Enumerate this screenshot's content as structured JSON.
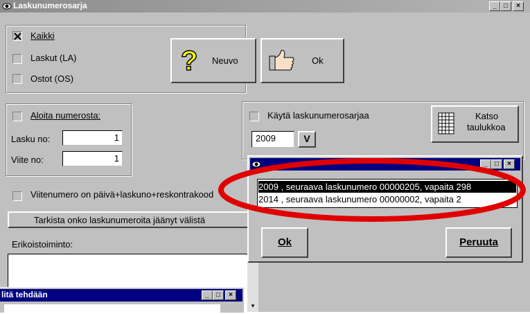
{
  "main_window": {
    "title": "Laskunumerosarja",
    "title_buttons": [
      "_",
      "□",
      "×"
    ]
  },
  "filter_group": {
    "all_label": "Kaikki",
    "all_checked": true,
    "invoices_label": "Laskut (LA)",
    "purchases_label": "Ostot (OS)"
  },
  "buttons": {
    "new_label": "Neuvo",
    "ok_label": "Ok",
    "view_table_line1": "Katso",
    "view_table_line2": "taulukkoa",
    "year_dropdown": "V",
    "check_gaps_label": "Tarkista onko laskunumeroita jäänyt välistä"
  },
  "start_group": {
    "start_from_label": "Aloita numerosta:",
    "invoice_no_label": "Lasku no:",
    "invoice_no_value": "1",
    "ref_no_label": "Viite no:",
    "ref_no_value": "1"
  },
  "series_group": {
    "use_series_label": "Käytä laskunumerosarjaa",
    "year_value": "2009"
  },
  "reference_label": "Viitenumero on päivä+laskuno+reskontrakood",
  "special_label": "Erikoistoiminto:",
  "popup": {
    "title_buttons": [
      "_",
      "□",
      "×"
    ],
    "items": [
      "2009 , seuraava laskunumero 00000205, vapaita 298",
      "2014 , seuraava laskunumero 00000002, vapaita 2"
    ],
    "selected_index": 0,
    "ok_label": "Ok",
    "cancel_label": "Peruuta"
  },
  "bottom_window": {
    "title": "litä tehdään",
    "title_buttons": [
      "_",
      "□",
      "×"
    ]
  },
  "colors": {
    "face": "#c0c0c0",
    "active_title": "#000080",
    "highlight_ellipse": "#e00000",
    "selection": "#000000"
  }
}
